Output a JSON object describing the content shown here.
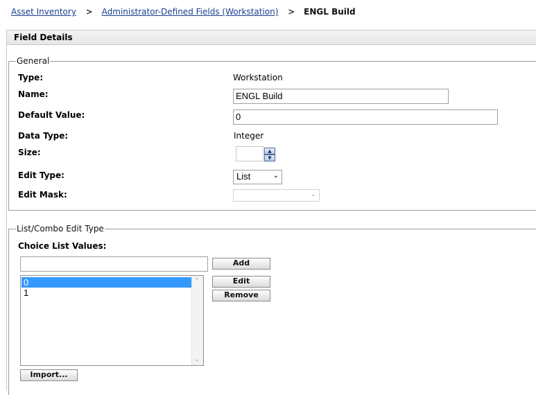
{
  "breadcrumb": {
    "items": [
      "Asset Inventory",
      "Administrator-Defined Fields (Workstation)"
    ],
    "separator": ">",
    "current": "ENGL Build"
  },
  "field_details": {
    "title": "Field Details"
  },
  "general": {
    "legend": "General",
    "type_label": "Type:",
    "type_value": "Workstation",
    "name_label": "Name:",
    "name_value": "ENGL Build",
    "default_label": "Default Value:",
    "default_value": "0",
    "data_type_label": "Data Type:",
    "data_type_value": "Integer",
    "size_label": "Size:",
    "size_value": "",
    "edit_type_label": "Edit Type:",
    "edit_type_value": "List",
    "edit_mask_label": "Edit Mask:",
    "edit_mask_value": ""
  },
  "list_combo": {
    "legend": "List/Combo Edit Type",
    "choice_label": "Choice List Values:",
    "new_value": "",
    "items": [
      "0",
      "1"
    ],
    "selected_index": 0,
    "add_label": "Add",
    "edit_label": "Edit",
    "remove_label": "Remove",
    "import_label": "Import..."
  },
  "colors": {
    "link": "#1a3f8f",
    "selection": "#3399ff"
  }
}
